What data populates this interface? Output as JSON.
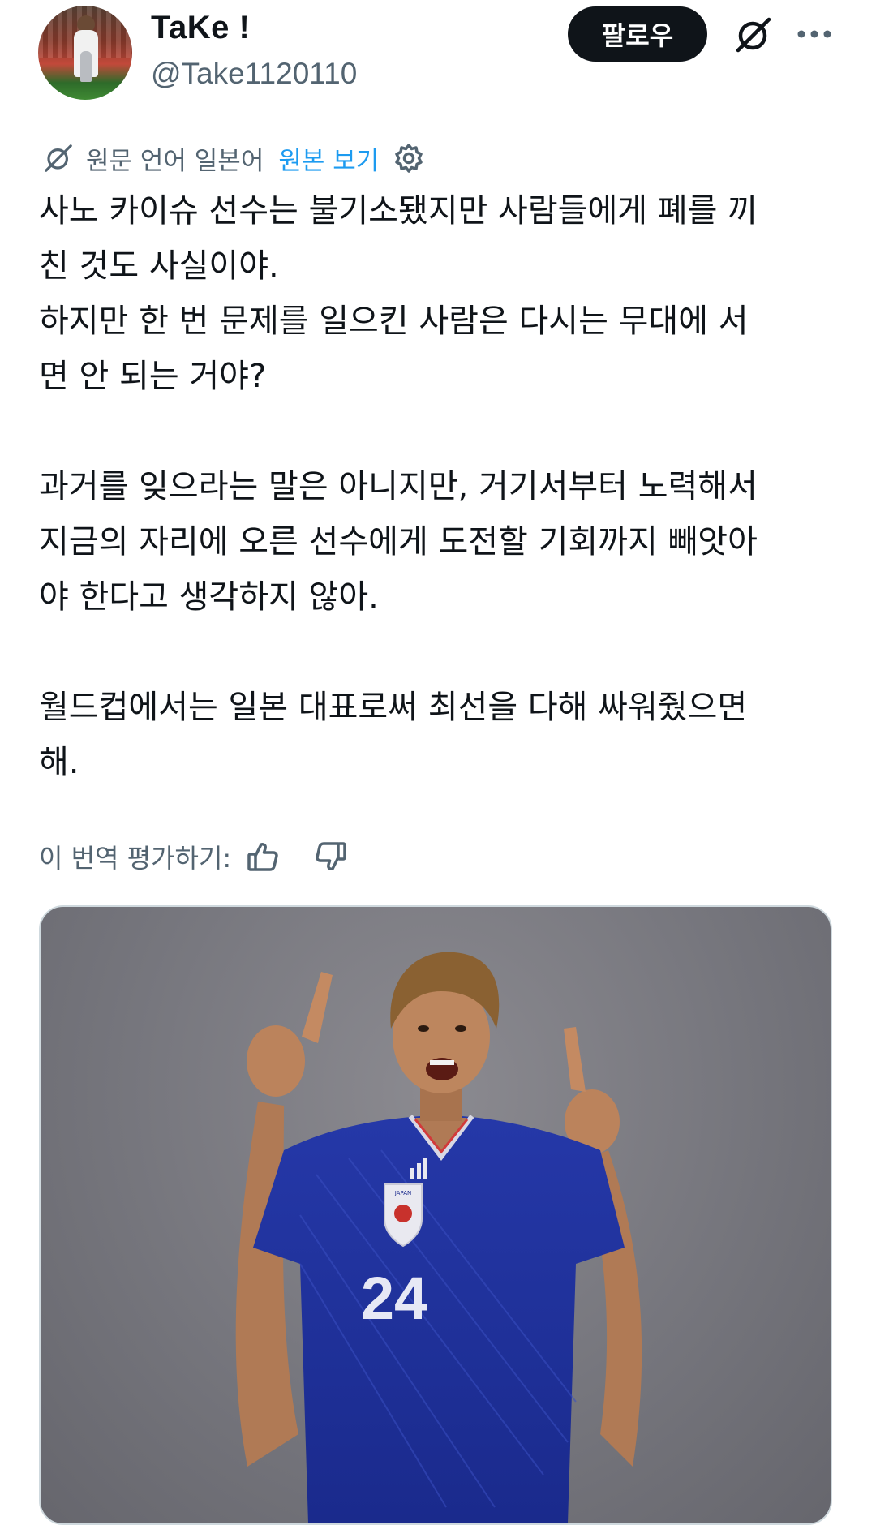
{
  "author": {
    "display_name": "TaKe !",
    "handle": "@Take1120110"
  },
  "header": {
    "follow_label": "팔로우"
  },
  "translation": {
    "info": "원문 언어 일본어",
    "show_original": "원본 보기"
  },
  "tweet": {
    "lines": [
      "사노 카이슈 선수는 불기소됐지만 사람들에게 폐를 끼",
      "친 것도 사실이야.",
      "하지만 한 번 문제를 일으킨 사람은 다시는 무대에 서",
      "면 안 되는 거야?",
      "과거를 잊으라는 말은 아니지만, 거기서부터 노력해서",
      "지금의 자리에 오른 선수에게 도전할 기회까지 빼앗아",
      "야 한다고 생각하지 않아.",
      "월드컵에서는 일본 대표로써 최선을 다해 싸워줬으면",
      "해."
    ]
  },
  "rating": {
    "label": "이 번역 평가하기:"
  },
  "media": {
    "jersey_number": "24",
    "badge_text": "JAPAN"
  },
  "icons": {
    "grok": "grok-icon",
    "more": "more-icon",
    "settings": "gear-icon",
    "thumbs_up": "thumbs-up-icon",
    "thumbs_down": "thumbs-down-icon"
  },
  "colors": {
    "text": "#0f1419",
    "secondary": "#536471",
    "link": "#1d9bf0",
    "follow_bg": "#0f1419"
  }
}
